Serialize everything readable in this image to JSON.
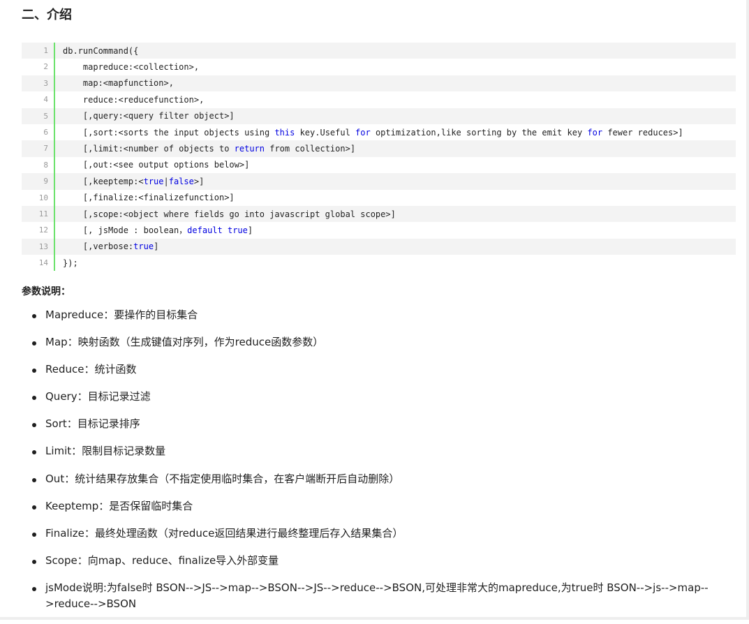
{
  "section_title": "二、介绍",
  "code": {
    "lines": [
      {
        "n": "1",
        "parts": [
          {
            "t": "db.runCommand({"
          }
        ]
      },
      {
        "n": "2",
        "parts": [
          {
            "t": "    mapreduce:<collection>,"
          }
        ]
      },
      {
        "n": "3",
        "parts": [
          {
            "t": "    map:<mapfunction>,"
          }
        ]
      },
      {
        "n": "4",
        "parts": [
          {
            "t": "    reduce:<reducefunction>,"
          }
        ]
      },
      {
        "n": "5",
        "parts": [
          {
            "t": "    [,query:<query filter object>]"
          }
        ]
      },
      {
        "n": "6",
        "parts": [
          {
            "t": "    [,sort:<sorts the input objects using "
          },
          {
            "t": "this",
            "kw": true
          },
          {
            "t": " key.Useful "
          },
          {
            "t": "for",
            "kw": true
          },
          {
            "t": " optimization,like sorting by the emit key "
          },
          {
            "t": "for",
            "kw": true
          },
          {
            "t": " fewer reduces>]"
          }
        ]
      },
      {
        "n": "7",
        "parts": [
          {
            "t": "    [,limit:<number of objects to "
          },
          {
            "t": "return",
            "kw": true
          },
          {
            "t": " from collection>]"
          }
        ]
      },
      {
        "n": "8",
        "parts": [
          {
            "t": "    [,out:<see output options below>]"
          }
        ]
      },
      {
        "n": "9",
        "parts": [
          {
            "t": "    [,keeptemp:<"
          },
          {
            "t": "true",
            "kw": true
          },
          {
            "t": "|"
          },
          {
            "t": "false",
            "kw": true
          },
          {
            "t": ">]"
          }
        ]
      },
      {
        "n": "10",
        "parts": [
          {
            "t": "    [,finalize:<finalizefunction>]"
          }
        ]
      },
      {
        "n": "11",
        "parts": [
          {
            "t": "    [,scope:<object where fields go into javascript global scope>]"
          }
        ]
      },
      {
        "n": "12",
        "parts": [
          {
            "t": "    [, jsMode : boolean，"
          },
          {
            "t": "default",
            "kw": true
          },
          {
            "t": " "
          },
          {
            "t": "true",
            "kw": true
          },
          {
            "t": "]"
          }
        ]
      },
      {
        "n": "13",
        "parts": [
          {
            "t": "    [,verbose:"
          },
          {
            "t": "true",
            "kw": true
          },
          {
            "t": "]"
          }
        ]
      },
      {
        "n": "14",
        "parts": [
          {
            "t": "});"
          }
        ]
      }
    ]
  },
  "params_title": "参数说明：",
  "params": [
    "Mapreduce：要操作的目标集合",
    "Map：映射函数（生成键值对序列，作为reduce函数参数）",
    "Reduce：统计函数",
    "Query：目标记录过滤",
    "Sort：目标记录排序",
    "Limit：限制目标记录数量",
    "Out：统计结果存放集合（不指定使用临时集合，在客户端断开后自动删除）",
    "Keeptemp：是否保留临时集合",
    "Finalize：最终处理函数（对reduce返回结果进行最终整理后存入结果集合）",
    "Scope：向map、reduce、finalize导入外部变量",
    "jsMode说明:为false时 BSON-->JS-->map-->BSON-->JS-->reduce-->BSON,可处理非常大的mapreduce,为true时 BSON-->js-->map-->reduce-->BSON"
  ],
  "colors": {
    "keyword": "#0000e0",
    "gutter_bar": "#6ce26c",
    "stripe": "#f3f3f3"
  }
}
